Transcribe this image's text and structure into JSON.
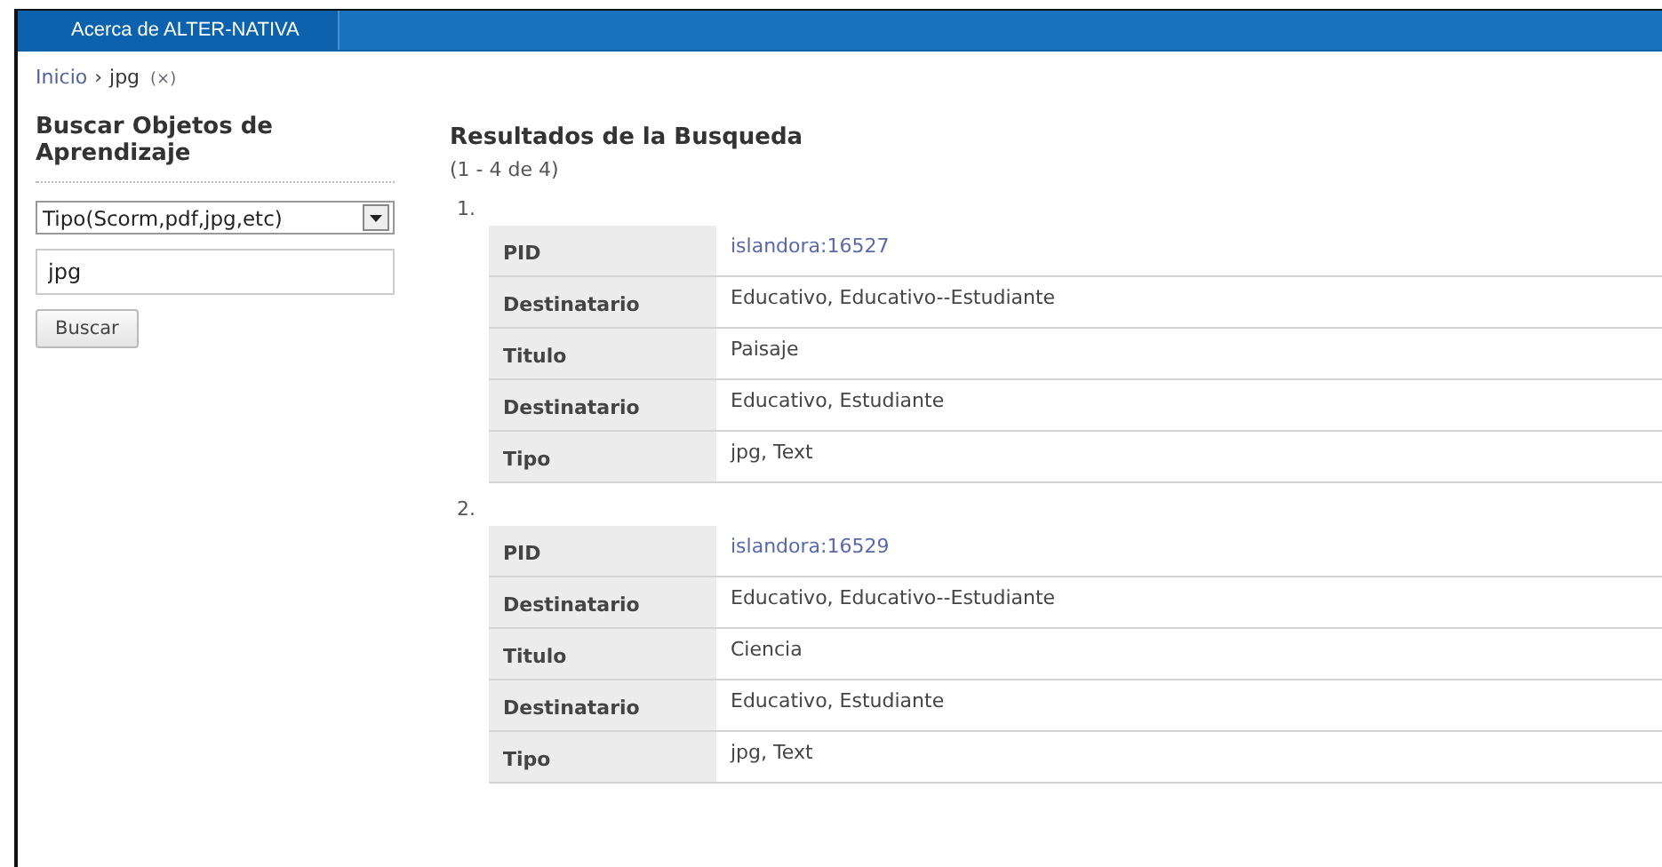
{
  "top_bar": {
    "tabs": [
      {
        "label": "Acerca de ALTER-NATIVA",
        "selected": true
      }
    ]
  },
  "breadcrumb": {
    "items": [
      {
        "label": "Inicio",
        "kind": "link"
      },
      {
        "label": "jpg",
        "kind": "current"
      }
    ],
    "separator": "›",
    "remove": "(×)"
  },
  "sidebar": {
    "title": "Buscar Objetos de Aprendizaje",
    "select": {
      "value": "Tipo(Scorm,pdf,jpg,etc)"
    },
    "search": {
      "value": "jpg"
    },
    "button": "Buscar"
  },
  "results": {
    "title": "Resultados de la Busqueda",
    "count": "(1 - 4 de 4)",
    "items": [
      {
        "number": "1.",
        "rows": [
          {
            "label": "PID",
            "value": "islandora:16527",
            "kind": "link"
          },
          {
            "label": "Destinatario",
            "value": "Educativo, Educativo--Estudiante",
            "kind": "text"
          },
          {
            "label": "Titulo",
            "value": "Paisaje",
            "kind": "text"
          },
          {
            "label": "Destinatario",
            "value": "Educativo, Estudiante",
            "kind": "text"
          },
          {
            "label": "Tipo",
            "value": "jpg, Text",
            "kind": "text"
          }
        ]
      },
      {
        "number": "2.",
        "rows": [
          {
            "label": "PID",
            "value": "islandora:16529",
            "kind": "link"
          },
          {
            "label": "Destinatario",
            "value": "Educativo, Educativo--Estudiante",
            "kind": "text"
          },
          {
            "label": "Titulo",
            "value": "Ciencia",
            "kind": "text"
          },
          {
            "label": "Destinatario",
            "value": "Educativo, Estudiante",
            "kind": "text"
          },
          {
            "label": "Tipo",
            "value": "jpg, Text",
            "kind": "text"
          }
        ]
      }
    ]
  }
}
